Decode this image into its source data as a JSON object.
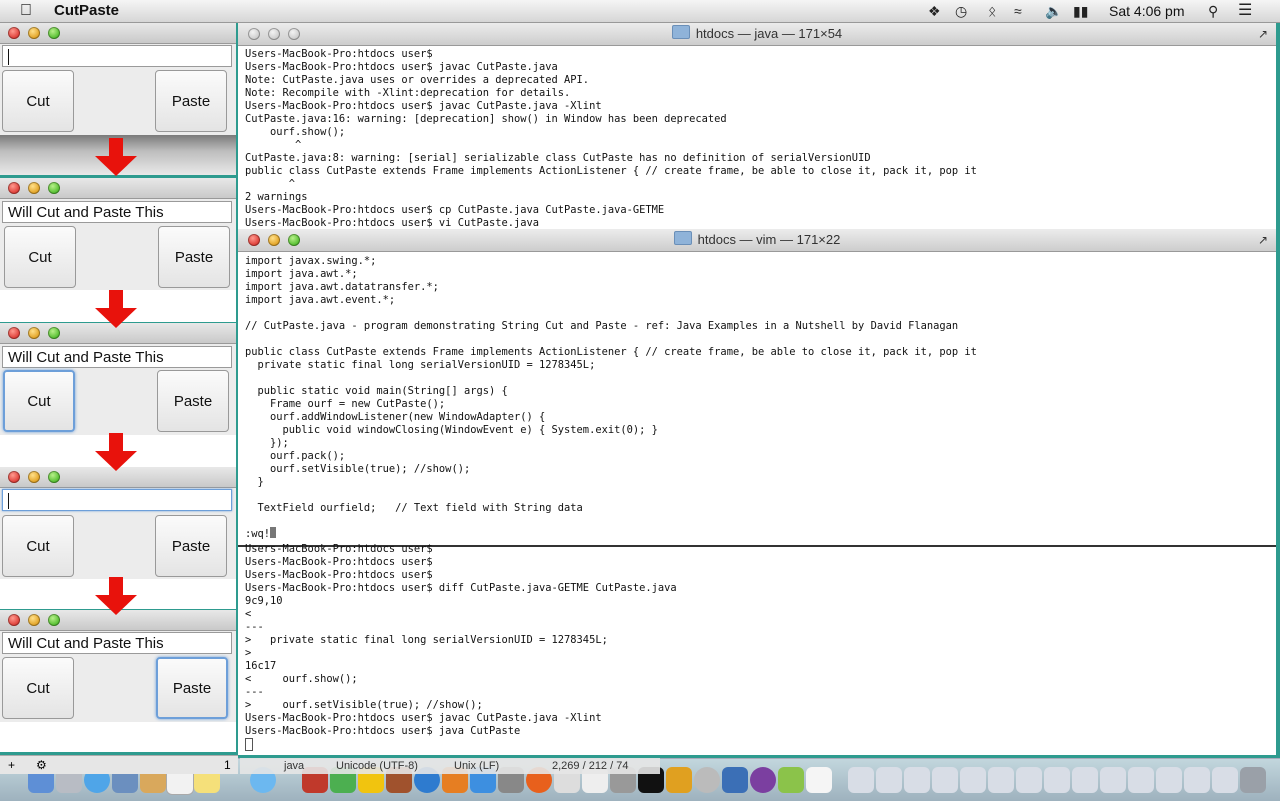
{
  "menubar": {
    "app_name": "CutPaste",
    "clock": "Sat 4:06 pm",
    "icons": [
      "apple-icon",
      "dropbox-icon",
      "time-machine-icon",
      "bluetooth-icon",
      "wifi-icon",
      "volume-icon",
      "battery-icon",
      "spotlight-icon",
      "notification-icon"
    ]
  },
  "java_windows": [
    {
      "text": "",
      "cut_label": "Cut",
      "paste_label": "Paste"
    },
    {
      "text": "Will Cut and Paste This",
      "cut_label": "Cut",
      "paste_label": "Paste"
    },
    {
      "text": "Will Cut and Paste This",
      "cut_label": "Cut",
      "paste_label": "Paste"
    },
    {
      "text": "",
      "cut_label": "Cut",
      "paste_label": "Paste"
    },
    {
      "text": "Will Cut and Paste This",
      "cut_label": "Cut",
      "paste_label": "Paste"
    }
  ],
  "terminal_top": {
    "title": "htdocs — java — 171×54",
    "lines": "Users-MacBook-Pro:htdocs user$\nUsers-MacBook-Pro:htdocs user$ javac CutPaste.java\nNote: CutPaste.java uses or overrides a deprecated API.\nNote: Recompile with -Xlint:deprecation for details.\nUsers-MacBook-Pro:htdocs user$ javac CutPaste.java -Xlint\nCutPaste.java:16: warning: [deprecation] show() in Window has been deprecated\n    ourf.show();\n        ^\nCutPaste.java:8: warning: [serial] serializable class CutPaste has no definition of serialVersionUID\npublic class CutPaste extends Frame implements ActionListener { // create frame, be able to close it, pack it, pop it\n       ^\n2 warnings\nUsers-MacBook-Pro:htdocs user$ cp CutPaste.java CutPaste.java-GETME\nUsers-MacBook-Pro:htdocs user$ vi CutPaste.java"
  },
  "terminal_vim": {
    "title": "htdocs — vim — 171×22",
    "lines": "import javax.swing.*;\nimport java.awt.*;\nimport java.awt.datatransfer.*;\nimport java.awt.event.*;\n\n// CutPaste.java - program demonstrating String Cut and Paste - ref: Java Examples in a Nutshell by David Flanagan\n\npublic class CutPaste extends Frame implements ActionListener { // create frame, be able to close it, pack it, pop it\n  private static final long serialVersionUID = 1278345L;\n\n  public static void main(String[] args) {\n    Frame ourf = new CutPaste();\n    ourf.addWindowListener(new WindowAdapter() {\n      public void windowClosing(WindowEvent e) { System.exit(0); }\n    });\n    ourf.pack();\n    ourf.setVisible(true); //show();\n  }\n\n  TextField ourfield;   // Text field with String data\n",
    "command": ":wq!"
  },
  "terminal_bottom": {
    "lines": "Users-MacBook-Pro:htdocs user$\nUsers-MacBook-Pro:htdocs user$\nUsers-MacBook-Pro:htdocs user$\nUsers-MacBook-Pro:htdocs user$ diff CutPaste.java-GETME CutPaste.java\n9c9,10\n<\n---\n>   private static final long serialVersionUID = 1278345L;\n>\n16c17\n<     ourf.show();\n---\n>     ourf.setVisible(true); //show();\nUsers-MacBook-Pro:htdocs user$ javac CutPaste.java -Xlint\nUsers-MacBook-Pro:htdocs user$ java CutPaste"
  },
  "statusbar": {
    "line": "1",
    "lang": "java",
    "encoding": "Unicode (UTF-8)",
    "eol": "Unix (LF)",
    "position": "2,269 / 212 / 74"
  },
  "colors": {
    "desktop": "#2e9b8f",
    "arrow": "#e8120c",
    "focus": "#6d9fd9"
  }
}
